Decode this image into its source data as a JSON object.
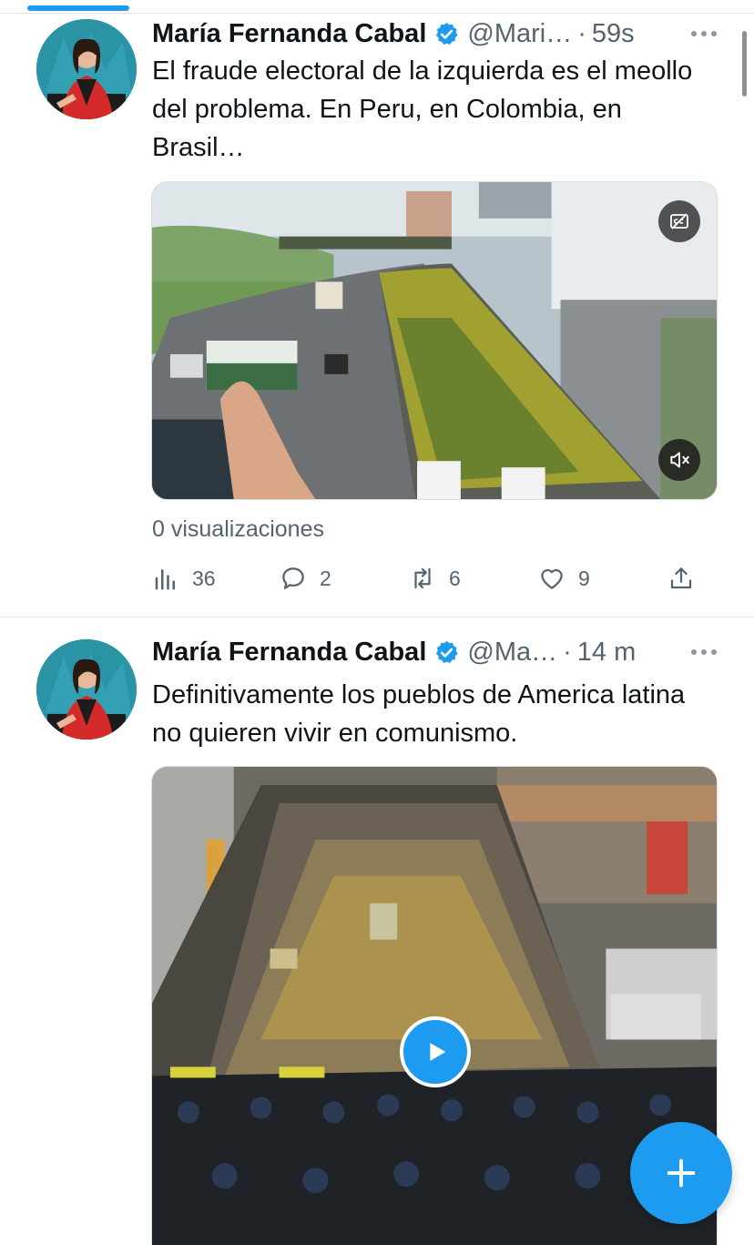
{
  "colors": {
    "accent": "#1d9bf0",
    "text": "#0f1419",
    "secondary": "#536471"
  },
  "tweets": [
    {
      "author_name": "María Fernanda Cabal",
      "handle": "@Mari…",
      "separator": "·",
      "time": "59s",
      "more_icon": "more-icon",
      "text": "El fraude electoral de la izquierda es el meollo del problema. En Peru, en Colombia, en Brasil…",
      "views": "0 visualizaciones",
      "actions": {
        "views_count": "36",
        "replies": "2",
        "retweets": "6",
        "likes": "9"
      }
    },
    {
      "author_name": "María Fernanda Cabal",
      "handle": "@Ma…",
      "separator": "·",
      "time": "14 m",
      "more_icon": "more-icon",
      "text": "Definitivamente los pueblos de America latina no quieren vivir en comunismo."
    }
  ],
  "fab": {
    "icon": "plus-icon"
  }
}
